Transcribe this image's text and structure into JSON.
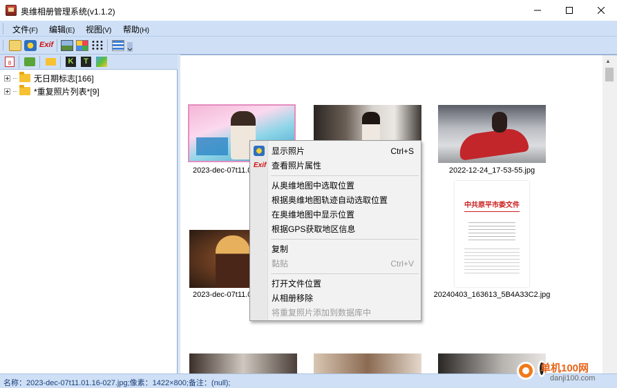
{
  "window": {
    "title": "奥维相册管理系统(v1.1.2)"
  },
  "menu": [
    {
      "label": "文件",
      "accel": "(F)"
    },
    {
      "label": "编辑",
      "accel": "(E)"
    },
    {
      "label": "视图",
      "accel": "(V)"
    },
    {
      "label": "帮助",
      "accel": "(H)"
    }
  ],
  "toolbar": {
    "exif_label": "Exif"
  },
  "left_toolbar": {
    "k_label": "K",
    "t_label": "T",
    "calendar_label": "8"
  },
  "tree": [
    {
      "label": "无日期标志[166]"
    },
    {
      "label": "*重复照片列表*[9]"
    }
  ],
  "thumbnails": [
    {
      "label": "2023-dec-07t11.01.16-027.jpg"
    },
    {
      "label": ""
    },
    {
      "label": "2022-12-24_17-53-55.jpg"
    },
    {
      "label": "2023-dec-07t11.01.16-027.jpg"
    },
    {
      "label": ""
    },
    {
      "label": "20240403_163613_5B4A33C2.jpg"
    }
  ],
  "doc_thumb": {
    "heading": "中共原平市委文件"
  },
  "context_menu": {
    "exif_label": "Exif",
    "items": [
      {
        "label": "显示照片",
        "shortcut": "Ctrl+S",
        "enabled": true
      },
      {
        "label": "查看照片属性",
        "shortcut": "",
        "enabled": true
      },
      {
        "label": "从奥维地图中选取位置",
        "shortcut": "",
        "enabled": true
      },
      {
        "label": "根据奥维地图轨迹自动选取位置",
        "shortcut": "",
        "enabled": true
      },
      {
        "label": "在奥维地图中显示位置",
        "shortcut": "",
        "enabled": true
      },
      {
        "label": "根据GPS获取地区信息",
        "shortcut": "",
        "enabled": true
      },
      {
        "label": "复制",
        "shortcut": "",
        "enabled": true
      },
      {
        "label": "黏贴",
        "shortcut": "Ctrl+V",
        "enabled": false
      },
      {
        "label": "打开文件位置",
        "shortcut": "",
        "enabled": true
      },
      {
        "label": "从相册移除",
        "shortcut": "",
        "enabled": true
      },
      {
        "label": "将重复照片添加到数据库中",
        "shortcut": "",
        "enabled": false
      }
    ]
  },
  "status": {
    "text": "名称：2023-dec-07t11.01.16-027.jpg;像素：1422×800;备注：(null);"
  },
  "watermark": {
    "brand": "单机100网",
    "url": "danji100.com"
  },
  "colors": {
    "menubar": "#cfe0f6",
    "selection": "#e58cc0",
    "status_text": "#1b3f78"
  }
}
